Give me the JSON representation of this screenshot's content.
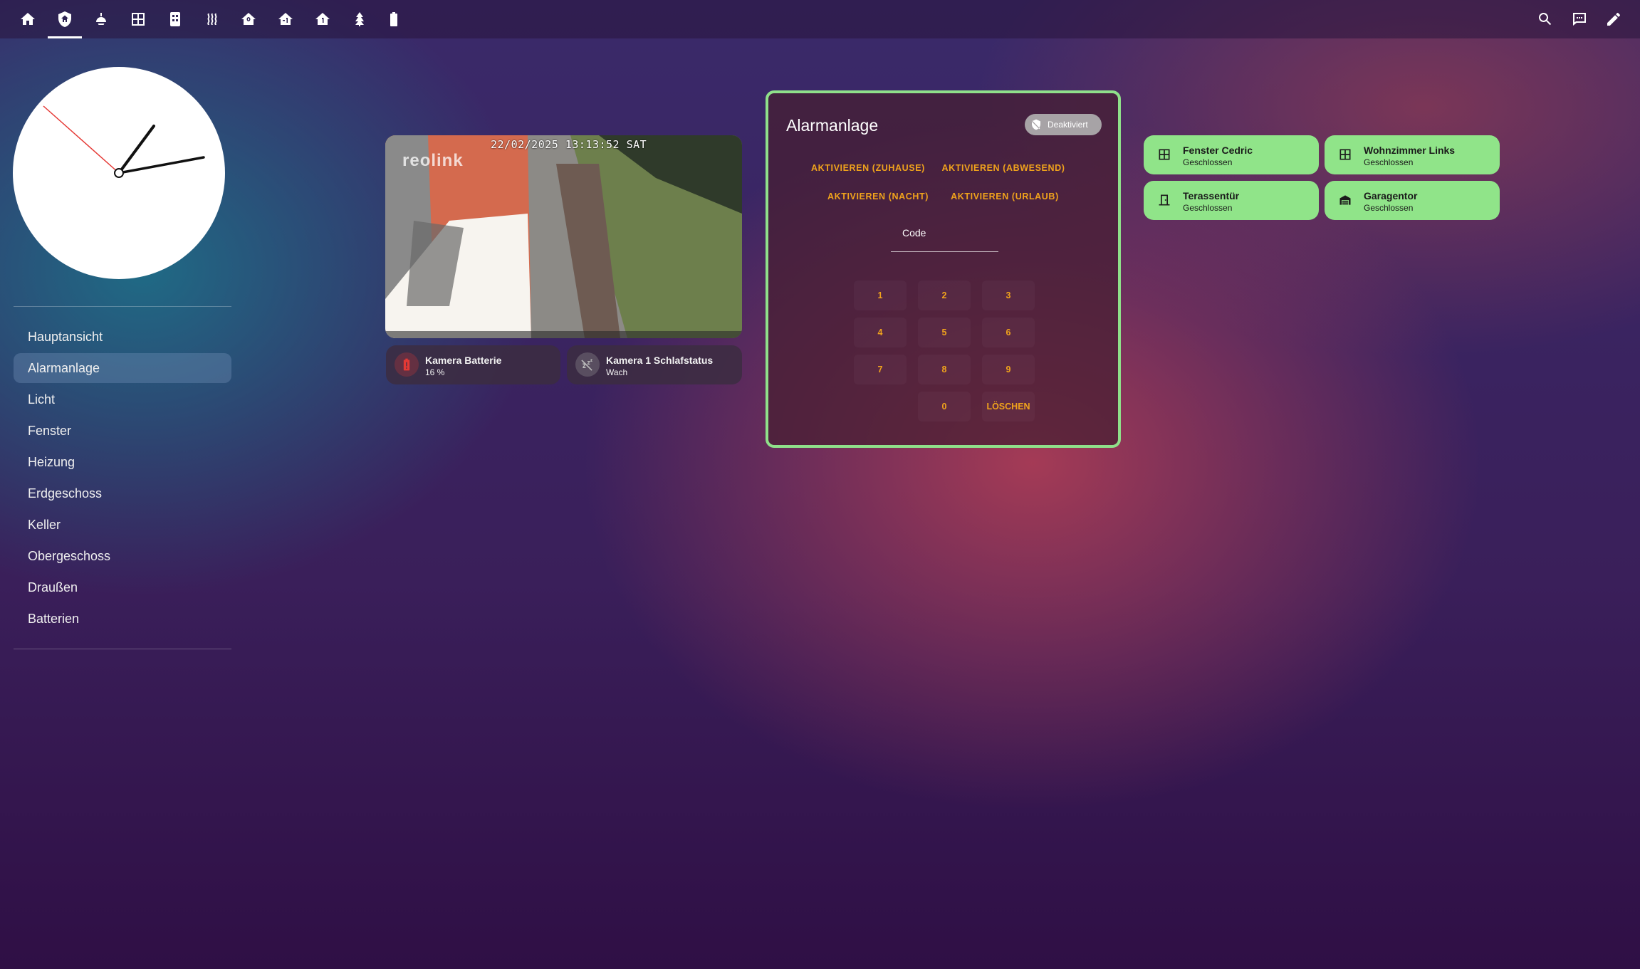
{
  "toolbar": {
    "tabs": [
      {
        "icon": "home-icon"
      },
      {
        "icon": "shield-home-icon"
      },
      {
        "icon": "ceiling-light-icon"
      },
      {
        "icon": "window-icon"
      },
      {
        "icon": "radiator-icon"
      },
      {
        "icon": "heat-wave-icon"
      },
      {
        "icon": "home-floor-0-icon"
      },
      {
        "icon": "home-floor-minus-1-icon"
      },
      {
        "icon": "home-floor-1-icon"
      },
      {
        "icon": "pine-tree-icon"
      },
      {
        "icon": "battery-icon"
      }
    ],
    "active_tab": 1,
    "actions": [
      {
        "icon": "search-icon"
      },
      {
        "icon": "assist-chat-icon"
      },
      {
        "icon": "edit-pencil-icon"
      }
    ]
  },
  "sidebar": {
    "items": [
      {
        "label": "Hauptansicht"
      },
      {
        "label": "Alarmanlage",
        "active": true
      },
      {
        "label": "Licht"
      },
      {
        "label": "Fenster"
      },
      {
        "label": "Heizung"
      },
      {
        "label": "Erdgeschoss"
      },
      {
        "label": "Keller"
      },
      {
        "label": "Obergeschoss"
      },
      {
        "label": "Draußen"
      },
      {
        "label": "Batterien"
      }
    ]
  },
  "camera": {
    "timestamp": "22/02/2025 13:13:52 SAT",
    "brand": "reolink"
  },
  "camera_tiles": [
    {
      "name": "Kamera Batterie",
      "state": "16 %",
      "icon": "battery-alert-icon",
      "color": "#e53935"
    },
    {
      "name": "Kamera 1 Schlafstatus",
      "state": "Wach",
      "icon": "sleep-off-icon",
      "color": "#9e9e9e"
    }
  ],
  "alarm": {
    "title": "Alarmanlage",
    "status": "Deaktiviert",
    "status_icon": "shield-off-icon",
    "arm_buttons": [
      "AKTIVIEREN (ZUHAUSE)",
      "AKTIVIEREN (ABWESEND)",
      "AKTIVIEREN (NACHT)",
      "AKTIVIEREN (URLAUB)"
    ],
    "code_label": "Code",
    "keys": [
      "1",
      "2",
      "3",
      "4",
      "5",
      "6",
      "7",
      "8",
      "9",
      "0"
    ],
    "clear_label": "LÖSCHEN",
    "accent": "#f0a31c",
    "border_color": "#8fe08a"
  },
  "sensors": [
    {
      "name": "Fenster Cedric",
      "state": "Geschlossen",
      "icon": "window-closed-icon"
    },
    {
      "name": "Wohnzimmer Links",
      "state": "Geschlossen",
      "icon": "window-closed-icon"
    },
    {
      "name": "Terassentür",
      "state": "Geschlossen",
      "icon": "door-closed-icon"
    },
    {
      "name": "Garagentor",
      "state": "Geschlossen",
      "icon": "garage-icon"
    }
  ],
  "sensor_color": "#90e489",
  "clock": {
    "time": "13:13:52"
  }
}
